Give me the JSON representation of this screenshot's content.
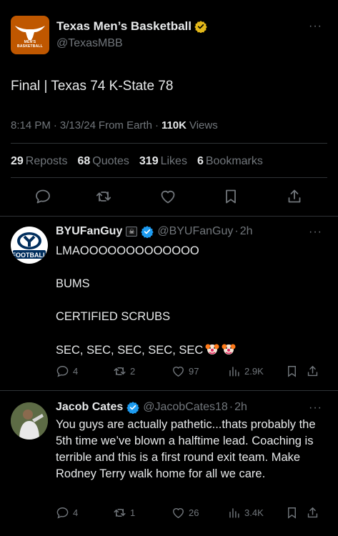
{
  "main_post": {
    "avatar_caption": "MEN'S BASKETBALL",
    "name": "Texas Men’s Basketball",
    "handle": "@TexasMBB",
    "text": "Final | Texas 74 K-State 78",
    "time": "8:14 PM",
    "date": "3/13/24",
    "source": "From Earth",
    "views_count": "110K",
    "views_label": "Views",
    "stats": {
      "reposts_count": "29",
      "reposts_label": "Reposts",
      "quotes_count": "68",
      "quotes_label": "Quotes",
      "likes_count": "319",
      "likes_label": "Likes",
      "bookmarks_count": "6",
      "bookmarks_label": "Bookmarks"
    },
    "actions": [
      "reply-icon",
      "repost-icon",
      "like-icon",
      "bookmark-icon",
      "share-icon"
    ]
  },
  "replies": [
    {
      "name": "BYUFanGuy",
      "flag": "🏴‍☠️",
      "handle": "@BYUFanGuy",
      "age": "2h",
      "avatar_text": "FOOTBALL",
      "lines": [
        "LMAOOOOOOOOOOOOO",
        "",
        "BUMS",
        "",
        "CERTIFIED SCRUBS",
        "",
        "SEC, SEC, SEC, SEC, SEC"
      ],
      "replies": "4",
      "reposts": "2",
      "likes": "97",
      "views": "2.9K"
    },
    {
      "name": "Jacob Cates",
      "handle": "@JacobCates18",
      "age": "2h",
      "text": "You guys are actually pathetic...thats probably the 5th time we’ve blown a halftime lead. Coaching is terrible and this is a first round exit team. Make Rodney Terry walk home for all we care.",
      "replies": "4",
      "reposts": "1",
      "likes": "26",
      "views": "3.4K"
    }
  ],
  "colors": {
    "background": "#000000",
    "text": "#e7e9ea",
    "muted": "#71767b",
    "divider": "#2f3336",
    "verified_blue": "#1d9bf0",
    "verified_gold": "#e2b719",
    "burnt_orange": "#bf5700"
  }
}
